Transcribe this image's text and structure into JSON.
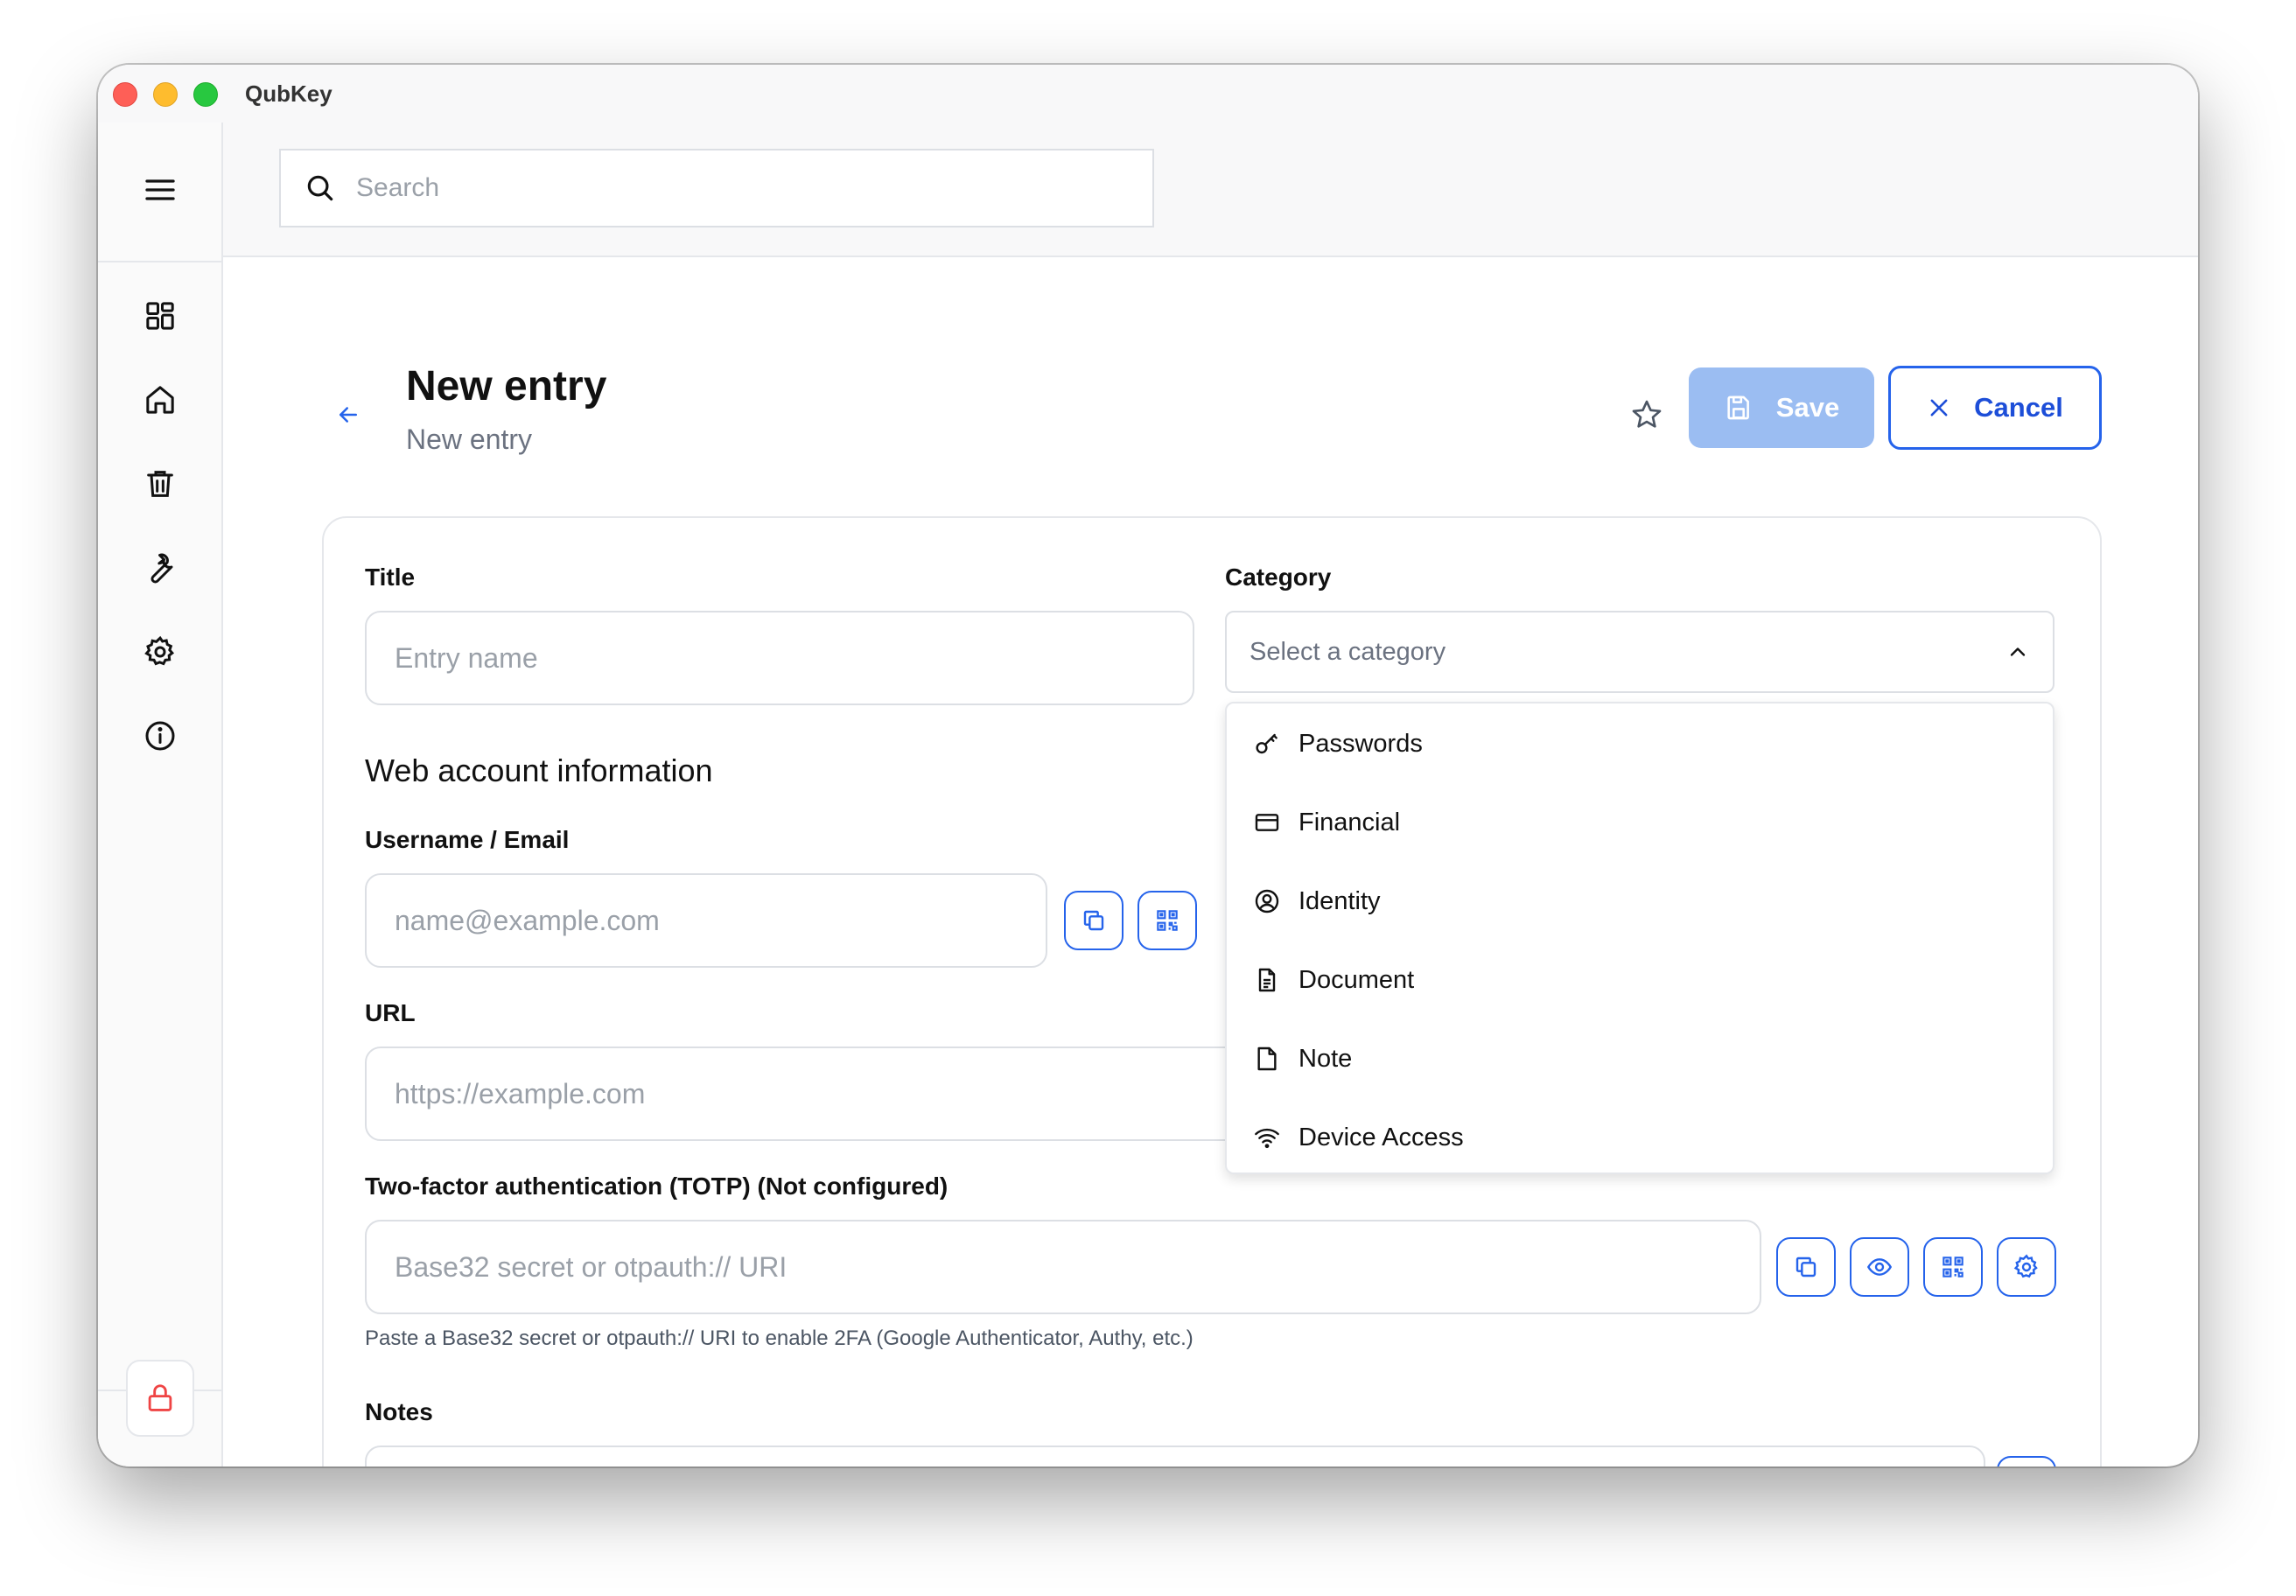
{
  "app": {
    "title": "QubKey"
  },
  "search": {
    "placeholder": "Search"
  },
  "header": {
    "title": "New entry",
    "subtitle": "New entry",
    "save_label": "Save",
    "cancel_label": "Cancel"
  },
  "form": {
    "title_label": "Title",
    "title_placeholder": "Entry name",
    "category_label": "Category",
    "category_placeholder": "Select a category",
    "section_title": "Web account information",
    "username_label": "Username / Email",
    "username_placeholder": "name@example.com",
    "url_label": "URL",
    "url_placeholder": "https://example.com",
    "totp_label": "Two-factor authentication (TOTP) (Not configured)",
    "totp_placeholder": "Base32 secret or otpauth:// URI",
    "totp_helper": "Paste a Base32 secret or otpauth:// URI to enable 2FA (Google Authenticator, Authy, etc.)",
    "notes_label": "Notes"
  },
  "categories": [
    {
      "label": "Passwords",
      "icon": "key-icon"
    },
    {
      "label": "Financial",
      "icon": "credit-card-icon"
    },
    {
      "label": "Identity",
      "icon": "user-circle-icon"
    },
    {
      "label": "Document",
      "icon": "document-icon"
    },
    {
      "label": "Note",
      "icon": "note-icon"
    },
    {
      "label": "Device Access",
      "icon": "wifi-icon"
    }
  ],
  "sidebar": {
    "items": [
      {
        "icon": "dashboard-icon"
      },
      {
        "icon": "home-icon"
      },
      {
        "icon": "trash-icon"
      },
      {
        "icon": "wrench-icon"
      },
      {
        "icon": "gear-icon"
      },
      {
        "icon": "info-icon"
      }
    ],
    "lock_icon": "lock-icon"
  },
  "colors": {
    "accent": "#2563eb",
    "save_disabled": "#9bbdf2",
    "lock": "#ef4444"
  }
}
